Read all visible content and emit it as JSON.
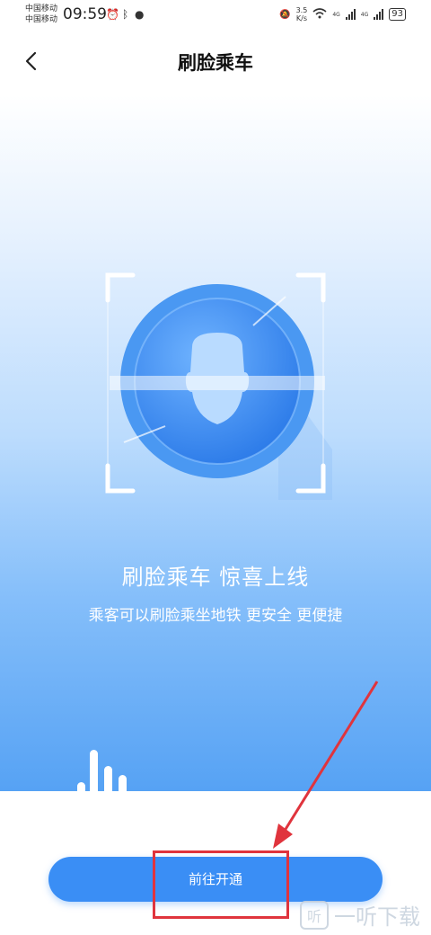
{
  "status_bar": {
    "carrier_1": "中国移动",
    "carrier_2": "中国移动",
    "time": "09:59",
    "speed_value": "3.5",
    "speed_unit": "K/s",
    "network_1": "4G",
    "network_2": "4G",
    "battery": "93"
  },
  "nav": {
    "title": "刷脸乘车"
  },
  "hero": {
    "headline": "刷脸乘车 惊喜上线",
    "subline": "乘客可以刷脸乘坐地铁 更安全 更便捷"
  },
  "cta": {
    "label": "前往开通"
  },
  "watermark": {
    "logo_char": "听",
    "text": "一听下载"
  },
  "colors": {
    "accent": "#3a8ef5",
    "highlight": "#e0343d"
  }
}
